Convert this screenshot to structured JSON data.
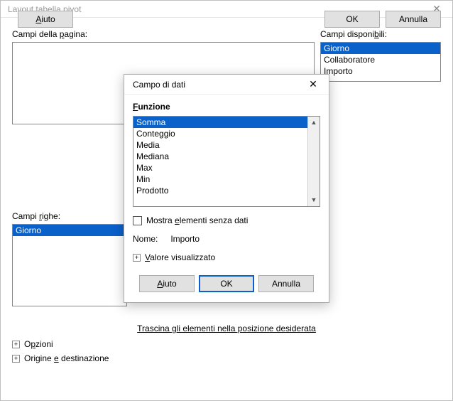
{
  "main": {
    "title": "Layout tabella pivot",
    "page_fields_label_pre": "Campi della ",
    "page_fields_label_u": "p",
    "page_fields_label_post": "agina:",
    "avail_fields_label_pre": "Campi disponi",
    "avail_fields_label_u": "b",
    "avail_fields_label_post": "ili:",
    "avail_items": [
      "Giorno",
      "Collaboratore",
      "Importo"
    ],
    "row_fields_label_pre": "Campi ",
    "row_fields_label_u": "r",
    "row_fields_label_post": "ighe:",
    "row_items": [
      "Giorno"
    ],
    "dragline": "Trascina gli elementi nella posizione desiderata",
    "exp1_pre": "O",
    "exp1_u": "p",
    "exp1_post": "zioni",
    "exp2_pre": "Origine ",
    "exp2_u": "e",
    "exp2_post": " destinazione",
    "help_u": "A",
    "help_post": "iuto",
    "ok": "OK",
    "cancel": "Annulla"
  },
  "dlg": {
    "title": "Campo di dati",
    "func_u": "F",
    "func_post": "unzione",
    "func_items": [
      "Somma",
      "Conteggio",
      "Media",
      "Mediana",
      "Max",
      "Min",
      "Prodotto"
    ],
    "show_empty_pre": "Mostra ",
    "show_empty_u": "e",
    "show_empty_post": "lementi senza dati",
    "name_lbl": "Nome:",
    "name_val": "Importo",
    "val_u": "V",
    "val_post": "alore visualizzato",
    "help_u": "A",
    "help_post": "iuto",
    "ok": "OK",
    "cancel": "Annulla"
  }
}
